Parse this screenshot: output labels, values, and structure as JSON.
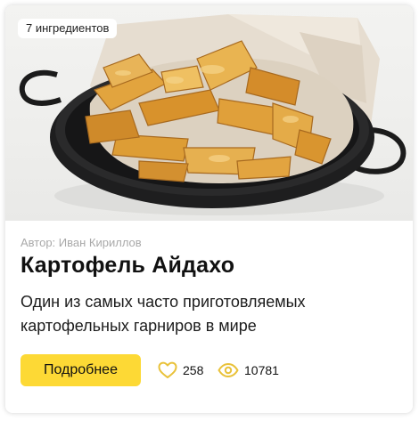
{
  "recipe": {
    "ingredients_badge": "7 ингредиентов",
    "author": "Автор: Иван Кириллов",
    "title": "Картофель Айдахо",
    "description": "Один из самых часто приготовляемых картофельных гарниров в мире",
    "more_button": "Подробнее",
    "likes": "258",
    "views": "10781"
  },
  "icons": {
    "likes": "heart-icon",
    "views": "eye-icon"
  },
  "colors": {
    "button": "#fdd935",
    "icon": "#e9c23a",
    "author_text": "#a9a9a9"
  }
}
